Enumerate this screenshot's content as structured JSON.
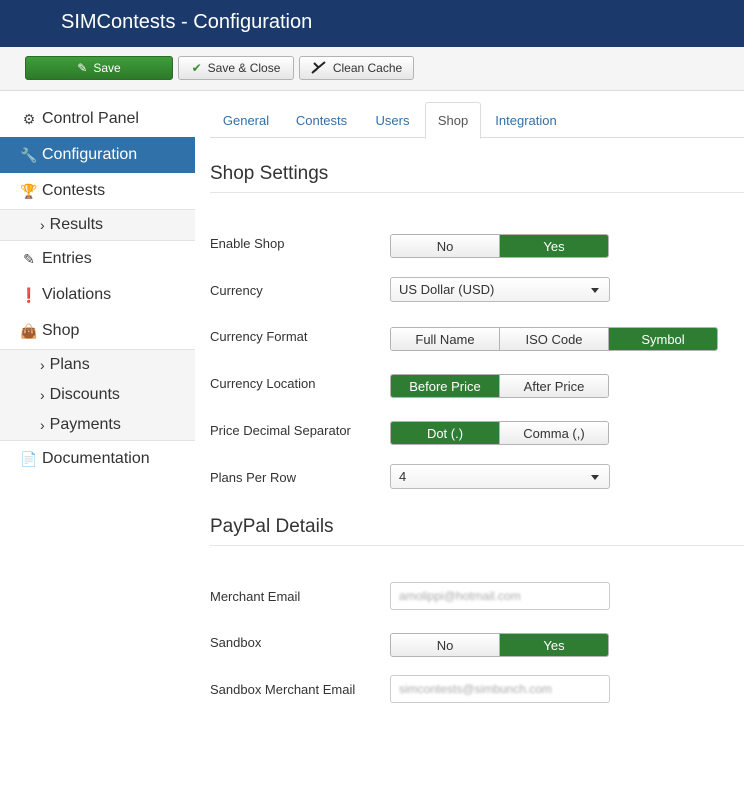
{
  "app": {
    "title": "SIMContests - Configuration"
  },
  "toolbar": {
    "save_label": "Save",
    "save_close_label": "Save & Close",
    "clean_cache_label": "Clean Cache"
  },
  "sidebar": {
    "items": [
      {
        "label": "Control Panel",
        "icon": "gears-icon"
      },
      {
        "label": "Configuration",
        "icon": "wrench-icon",
        "active": true
      },
      {
        "label": "Contests",
        "icon": "trophy-icon"
      },
      {
        "label": "Entries",
        "icon": "edit-icon"
      },
      {
        "label": "Violations",
        "icon": "exclamation-circle-icon"
      },
      {
        "label": "Shop",
        "icon": "shopping-bag-icon"
      },
      {
        "label": "Documentation",
        "icon": "document-icon"
      }
    ],
    "contests_sub": [
      {
        "label": "Results"
      }
    ],
    "shop_sub": [
      {
        "label": "Plans"
      },
      {
        "label": "Discounts"
      },
      {
        "label": "Payments"
      }
    ]
  },
  "tabs": [
    {
      "label": "General"
    },
    {
      "label": "Contests"
    },
    {
      "label": "Users"
    },
    {
      "label": "Shop",
      "active": true
    },
    {
      "label": "Integration"
    }
  ],
  "shop_settings": {
    "heading": "Shop Settings",
    "enable_shop": {
      "label": "Enable Shop",
      "options": [
        "No",
        "Yes"
      ],
      "selected": "Yes"
    },
    "currency": {
      "label": "Currency",
      "value": "US Dollar (USD)"
    },
    "currency_format": {
      "label": "Currency Format",
      "options": [
        "Full Name",
        "ISO Code",
        "Symbol"
      ],
      "selected": "Symbol"
    },
    "currency_location": {
      "label": "Currency Location",
      "options": [
        "Before Price",
        "After Price"
      ],
      "selected": "Before Price"
    },
    "decimal_separator": {
      "label": "Price Decimal Separator",
      "options": [
        "Dot (.)",
        "Comma (,)"
      ],
      "selected": "Dot (.)"
    },
    "plans_per_row": {
      "label": "Plans Per Row",
      "value": "4"
    }
  },
  "paypal": {
    "heading": "PayPal Details",
    "merchant_email": {
      "label": "Merchant Email",
      "value": "amolippi@hotmail.com"
    },
    "sandbox": {
      "label": "Sandbox",
      "options": [
        "No",
        "Yes"
      ],
      "selected": "Yes"
    },
    "sandbox_email": {
      "label": "Sandbox Merchant Email",
      "value": "simcontests@simbunch.com"
    }
  },
  "colors": {
    "header": "#1b3a6b",
    "active_nav": "#3071a9",
    "toggle_on": "#2f7d32"
  }
}
